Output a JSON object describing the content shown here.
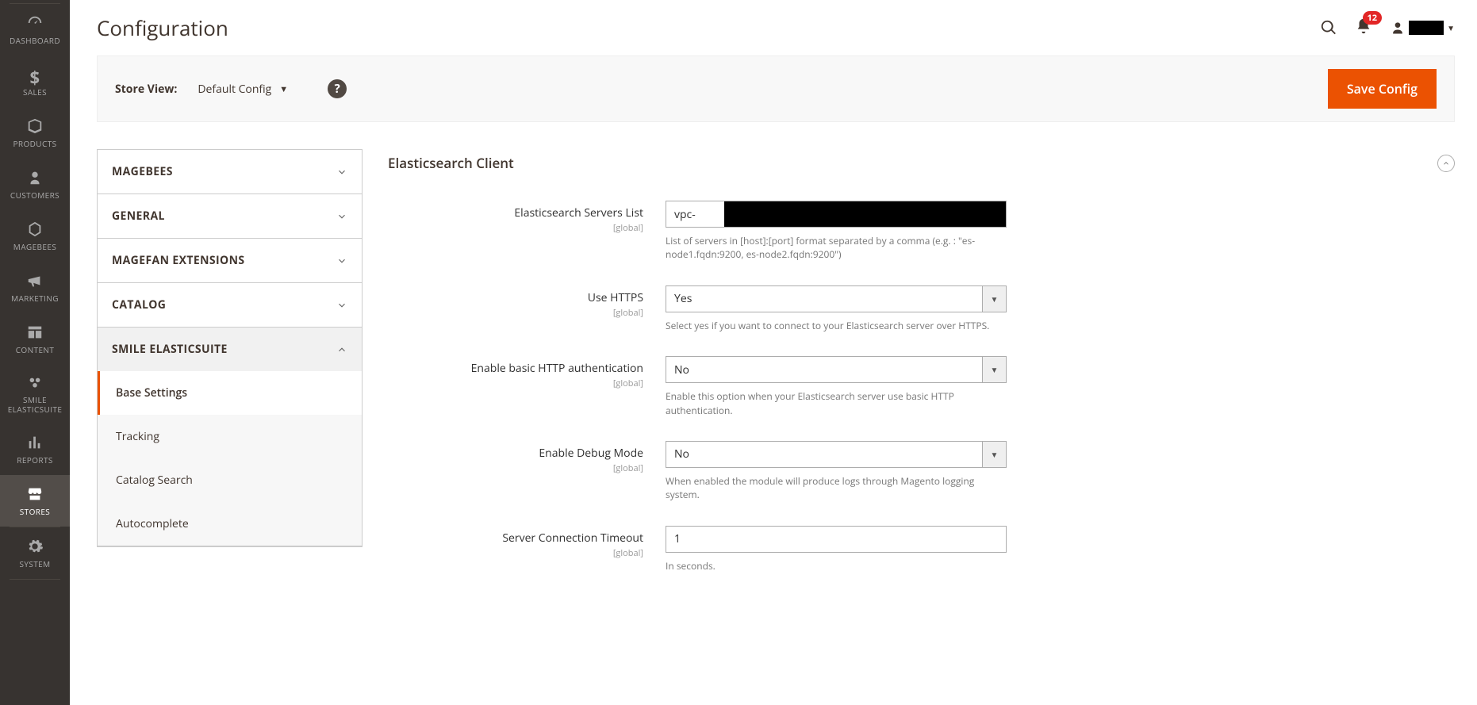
{
  "nav": {
    "items": [
      {
        "label": "DASHBOARD"
      },
      {
        "label": "SALES"
      },
      {
        "label": "PRODUCTS"
      },
      {
        "label": "CUSTOMERS"
      },
      {
        "label": "MAGEBEES"
      },
      {
        "label": "MARKETING"
      },
      {
        "label": "CONTENT"
      },
      {
        "label": "SMILE ELASTICSUITE"
      },
      {
        "label": "REPORTS"
      },
      {
        "label": "STORES"
      },
      {
        "label": "SYSTEM"
      }
    ]
  },
  "header": {
    "title": "Configuration",
    "notif_count": "12"
  },
  "storeview": {
    "label": "Store View:",
    "value": "Default Config",
    "save_label": "Save Config"
  },
  "sidepanel": {
    "sections": [
      {
        "label": "MAGEBEES"
      },
      {
        "label": "GENERAL"
      },
      {
        "label": "MAGEFAN EXTENSIONS"
      },
      {
        "label": "CATALOG"
      },
      {
        "label": "SMILE ELASTICSUITE"
      }
    ],
    "subs": [
      {
        "label": "Base Settings"
      },
      {
        "label": "Tracking"
      },
      {
        "label": "Catalog Search"
      },
      {
        "label": "Autocomplete"
      }
    ]
  },
  "section": {
    "title": "Elasticsearch Client"
  },
  "fields": {
    "servers": {
      "label": "Elasticsearch Servers List",
      "scope": "[global]",
      "value": "vpc-",
      "note": "List of servers in [host]:[port] format separated by a comma (e.g. : \"es-node1.fqdn:9200, es-node2.fqdn:9200\")"
    },
    "https": {
      "label": "Use HTTPS",
      "scope": "[global]",
      "value": "Yes",
      "note": "Select yes if you want to connect to your Elasticsearch server over HTTPS."
    },
    "basicauth": {
      "label": "Enable basic HTTP authentication",
      "scope": "[global]",
      "value": "No",
      "note": "Enable this option when your Elasticsearch server use basic HTTP authentication."
    },
    "debug": {
      "label": "Enable Debug Mode",
      "scope": "[global]",
      "value": "No",
      "note": "When enabled the module will produce logs through Magento logging system."
    },
    "timeout": {
      "label": "Server Connection Timeout",
      "scope": "[global]",
      "value": "1",
      "note": "In seconds."
    }
  }
}
